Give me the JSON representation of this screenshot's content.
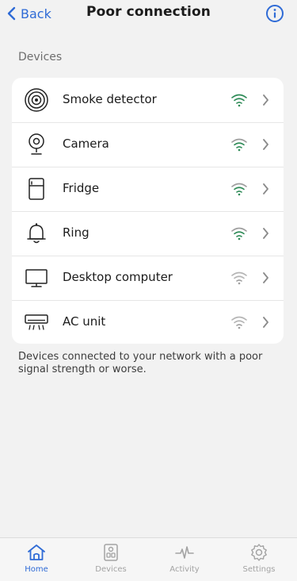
{
  "header": {
    "back_label": "Back",
    "title": "Poor connection",
    "back_icon": "chevron-left-icon",
    "info_icon": "info-icon"
  },
  "section_label": "Devices",
  "devices": [
    {
      "label": "Smoke detector",
      "icon": "smoke-detector-icon",
      "signal_color": "#2e8b57"
    },
    {
      "label": "Camera",
      "icon": "camera-icon",
      "signal_color": "#2e8b57"
    },
    {
      "label": "Fridge",
      "icon": "fridge-icon",
      "signal_color": "#2e8b57"
    },
    {
      "label": "Ring",
      "icon": "bell-icon",
      "signal_color": "#2e8b57"
    },
    {
      "label": "Desktop computer",
      "icon": "monitor-icon",
      "signal_color": "#9e9e9e"
    },
    {
      "label": "AC unit",
      "icon": "ac-unit-icon",
      "signal_color": "#9e9e9e"
    }
  ],
  "footnote": "Devices connected to your network with a poor signal strength or worse.",
  "tabs": [
    {
      "label": "Home",
      "icon": "home-icon",
      "active": true
    },
    {
      "label": "Devices",
      "icon": "devices-icon",
      "active": false
    },
    {
      "label": "Activity",
      "icon": "activity-icon",
      "active": false
    },
    {
      "label": "Settings",
      "icon": "settings-icon",
      "active": false
    }
  ],
  "colors": {
    "accent": "#2f6bd6",
    "background": "#f2f2f2",
    "card": "#ffffff",
    "signal_good": "#2e8b57",
    "signal_weak": "#9e9e9e"
  }
}
